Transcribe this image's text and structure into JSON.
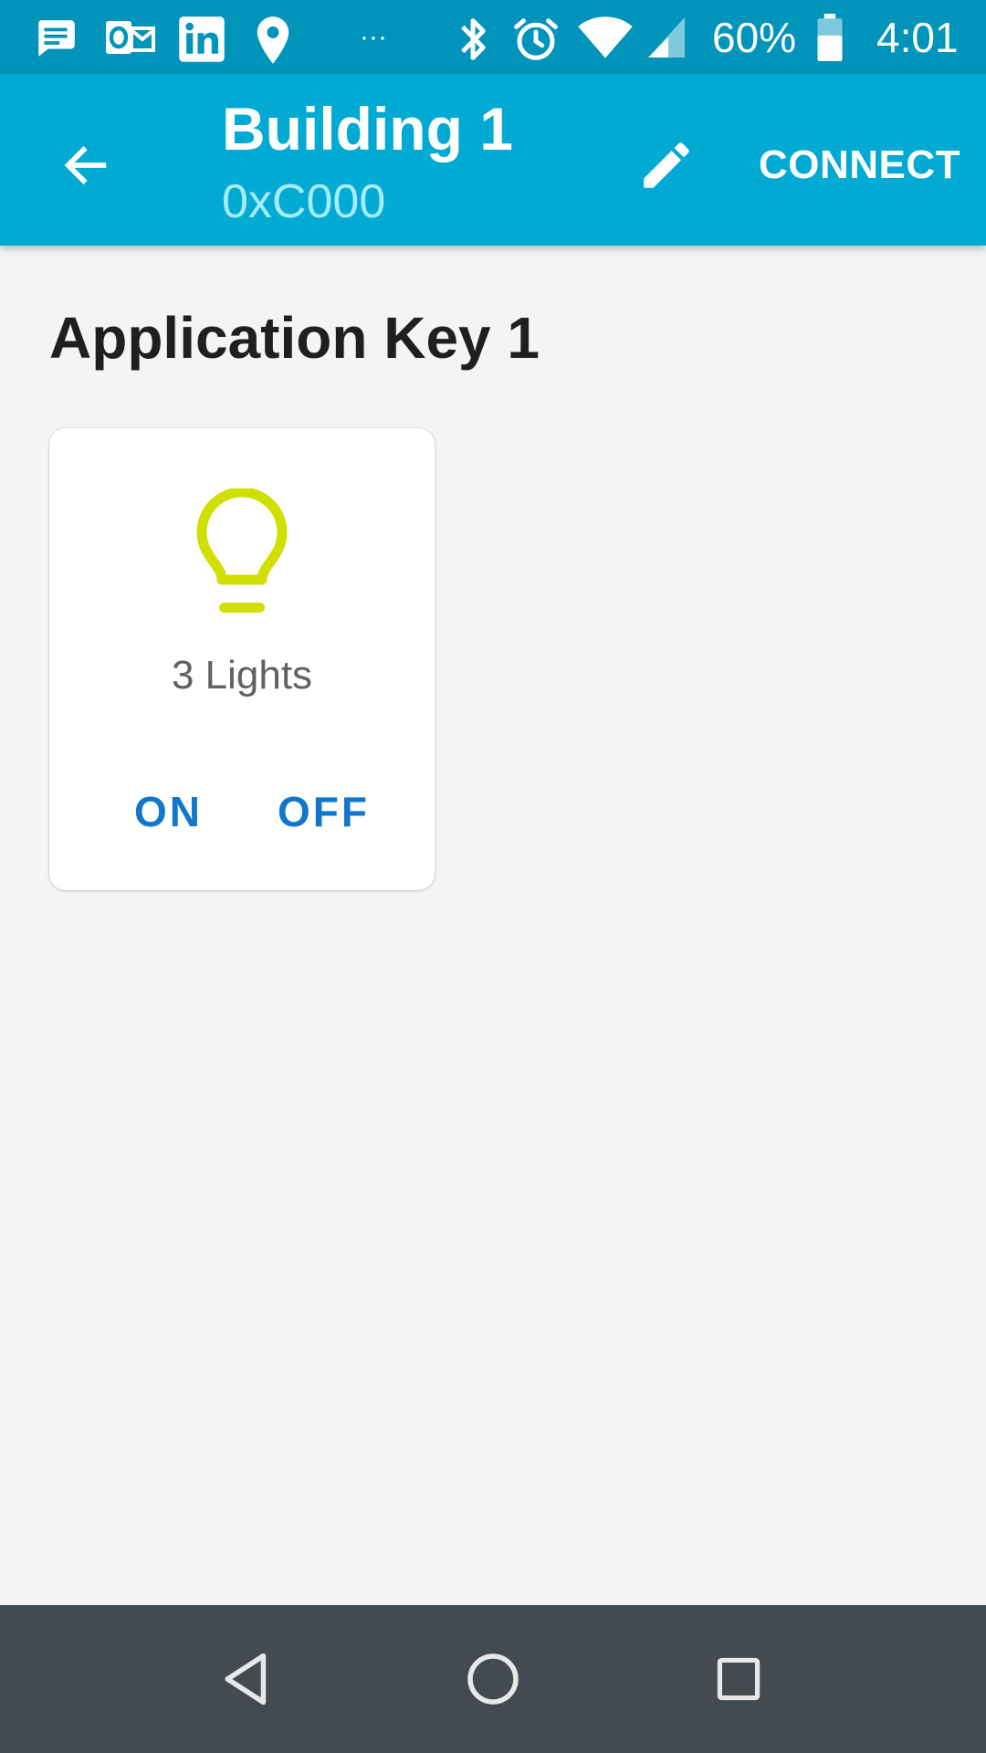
{
  "status_bar": {
    "icons": [
      "messages-icon",
      "outlook-icon",
      "linkedin-icon",
      "location-pin-icon",
      "more-dots-icon",
      "bluetooth-icon",
      "alarm-icon",
      "wifi-icon",
      "cell-signal-icon",
      "battery-icon"
    ],
    "more_indicator": "···",
    "battery_percent": "60%",
    "time": "4:01"
  },
  "app_bar": {
    "title": "Building 1",
    "subtitle": "0xC000",
    "back_icon": "arrow-back-icon",
    "edit_icon": "pencil-icon",
    "connect_label": "CONNECT"
  },
  "main": {
    "section_title": "Application Key 1",
    "card": {
      "icon": "lightbulb-icon",
      "label": "3 Lights",
      "on_label": "ON",
      "off_label": "OFF"
    }
  },
  "nav_bar": {
    "icons": [
      "nav-back-icon",
      "nav-home-icon",
      "nav-recents-icon"
    ]
  },
  "colors": {
    "status_bar": "#0094bb",
    "app_bar": "#00aad2",
    "subtitle": "#a4ecfb",
    "bulb": "#cfe000",
    "button_text": "#1177cc",
    "nav_bar": "#434a50",
    "background": "#f4f4f4"
  }
}
